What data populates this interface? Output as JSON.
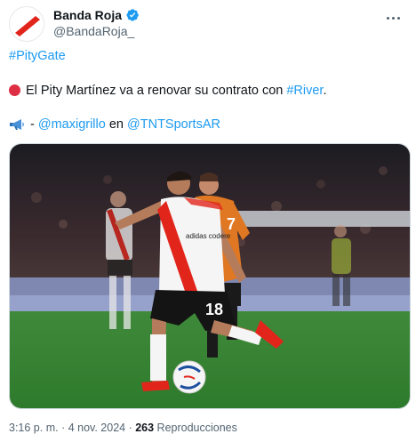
{
  "author": {
    "name": "Banda Roja",
    "handle": "@BandaRoja_",
    "verified": true,
    "avatar_icon": "red-diagonal-stripe-logo"
  },
  "tweet": {
    "hashtag_line": "#PityGate",
    "line2_text": "El Pity Martínez va a renovar su contrato con ",
    "line2_link": "#River",
    "line2_end": ".",
    "line3_sep": "- ",
    "line3_mention1": "@maxigrillo",
    "line3_mid": " en ",
    "line3_mention2": "@TNTSportsAR"
  },
  "media": {
    "jersey_sponsor": "adidas  codere",
    "jersey_number": "18",
    "defender_number": "7"
  },
  "meta": {
    "time": "3:16 p. m.",
    "sep1": " · ",
    "date": "4 nov. 2024",
    "sep2": " · ",
    "views": "263",
    "views_label": " Reproducciones"
  },
  "colors": {
    "accent": "#1d9bf0",
    "red": "#e1251b",
    "muted": "#536471"
  }
}
